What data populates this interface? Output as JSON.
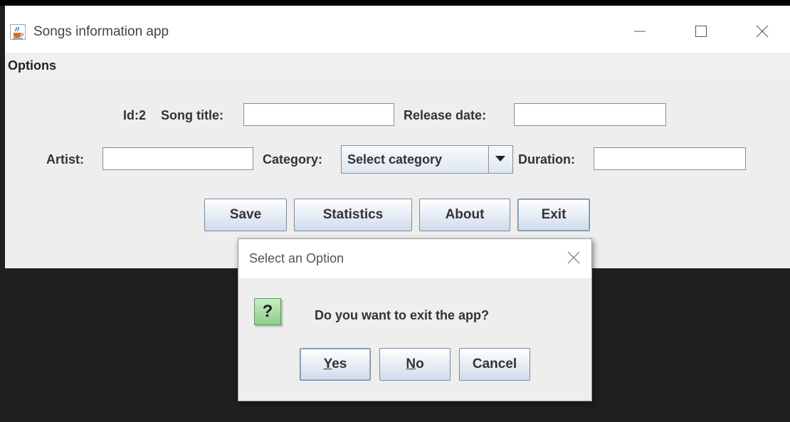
{
  "window": {
    "title": "Songs information app"
  },
  "menu": {
    "items": [
      "Options"
    ]
  },
  "form": {
    "id_label": "Id:2",
    "song_title_label": "Song title:",
    "song_title_value": "",
    "release_date_label": "Release date:",
    "release_date_value": "",
    "artist_label": "Artist:",
    "artist_value": "",
    "category_label": "Category:",
    "category_selected": "Select  category",
    "duration_label": "Duration:",
    "duration_value": ""
  },
  "buttons": {
    "save": "Save",
    "statistics": "Statistics",
    "about": "About",
    "exit": "Exit"
  },
  "dialog": {
    "title": "Select an Option",
    "message": "Do you want to exit the app?",
    "icon_glyph": "?",
    "yes_mnemonic": "Y",
    "yes_rest": "es",
    "no_mnemonic": "N",
    "no_rest": "o",
    "cancel": "Cancel"
  },
  "icons": {
    "app": "java-coffee-icon",
    "minimize": "minimize-icon",
    "maximize": "maximize-icon",
    "close": "close-icon",
    "dropdown": "triangle-down-icon",
    "question": "question-icon"
  }
}
